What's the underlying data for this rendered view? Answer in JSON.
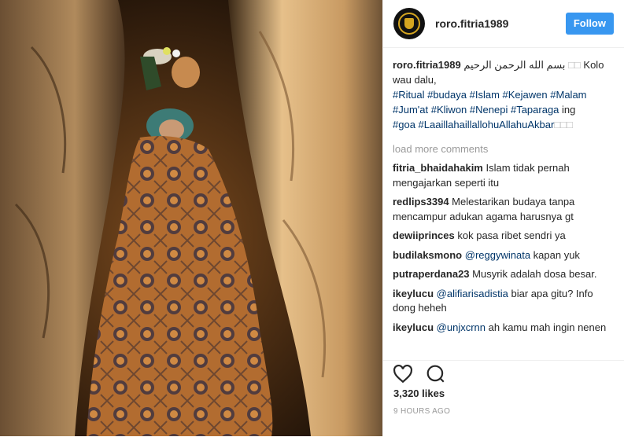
{
  "user": {
    "username": "roro.fitria1989"
  },
  "header": {
    "follow_label": "Follow"
  },
  "caption": {
    "username": "roro.fitria1989",
    "arabic": "بسم الله الرحمن الرحيم",
    "placeholder_glyphs": "□□",
    "text": "Kolo wau dalu,",
    "line2_tags": [
      "#Ritual",
      "#budaya",
      "#Islam",
      "#Kejawen",
      "#Malam"
    ],
    "line3_tags": [
      "#Jum'at",
      "#Kliwon",
      "#Nenepi",
      "#Taparaga"
    ],
    "line3_text": "ing",
    "line4_tags": [
      "#goa",
      "#LaaillahaillallohuAllahuAkbar"
    ],
    "line4_glyphs": "□□□"
  },
  "load_more": "load more comments",
  "comments": [
    {
      "user": "fitria_bhaidahakim",
      "mention": "",
      "text": "Islam tidak pernah mengajarkan seperti itu"
    },
    {
      "user": "redlips3394",
      "mention": "",
      "text": "Melestarikan budaya tanpa mencampur adukan agama harusnya gt"
    },
    {
      "user": "dewiiprinces",
      "mention": "",
      "text": "kok pasa ribet sendri ya"
    },
    {
      "user": "budilaksmono",
      "mention": "@reggywinata",
      "text": "kapan yuk"
    },
    {
      "user": "putraperdana23",
      "mention": "",
      "text": "Musyrik adalah dosa besar."
    },
    {
      "user": "ikeylucu",
      "mention": "@alifiarisadistia",
      "text": "biar apa gitu? Info dong heheh"
    },
    {
      "user": "ikeylucu",
      "mention": "@unjxcrnn",
      "text": "ah kamu mah ingin nenen"
    }
  ],
  "likes": "3,320 likes",
  "time": "9 HOURS AGO",
  "icons": {
    "like": "heart-icon",
    "comment": "comment-icon"
  },
  "colors": {
    "follow": "#3897f0",
    "hashtag": "#003569",
    "muted": "#999999"
  }
}
